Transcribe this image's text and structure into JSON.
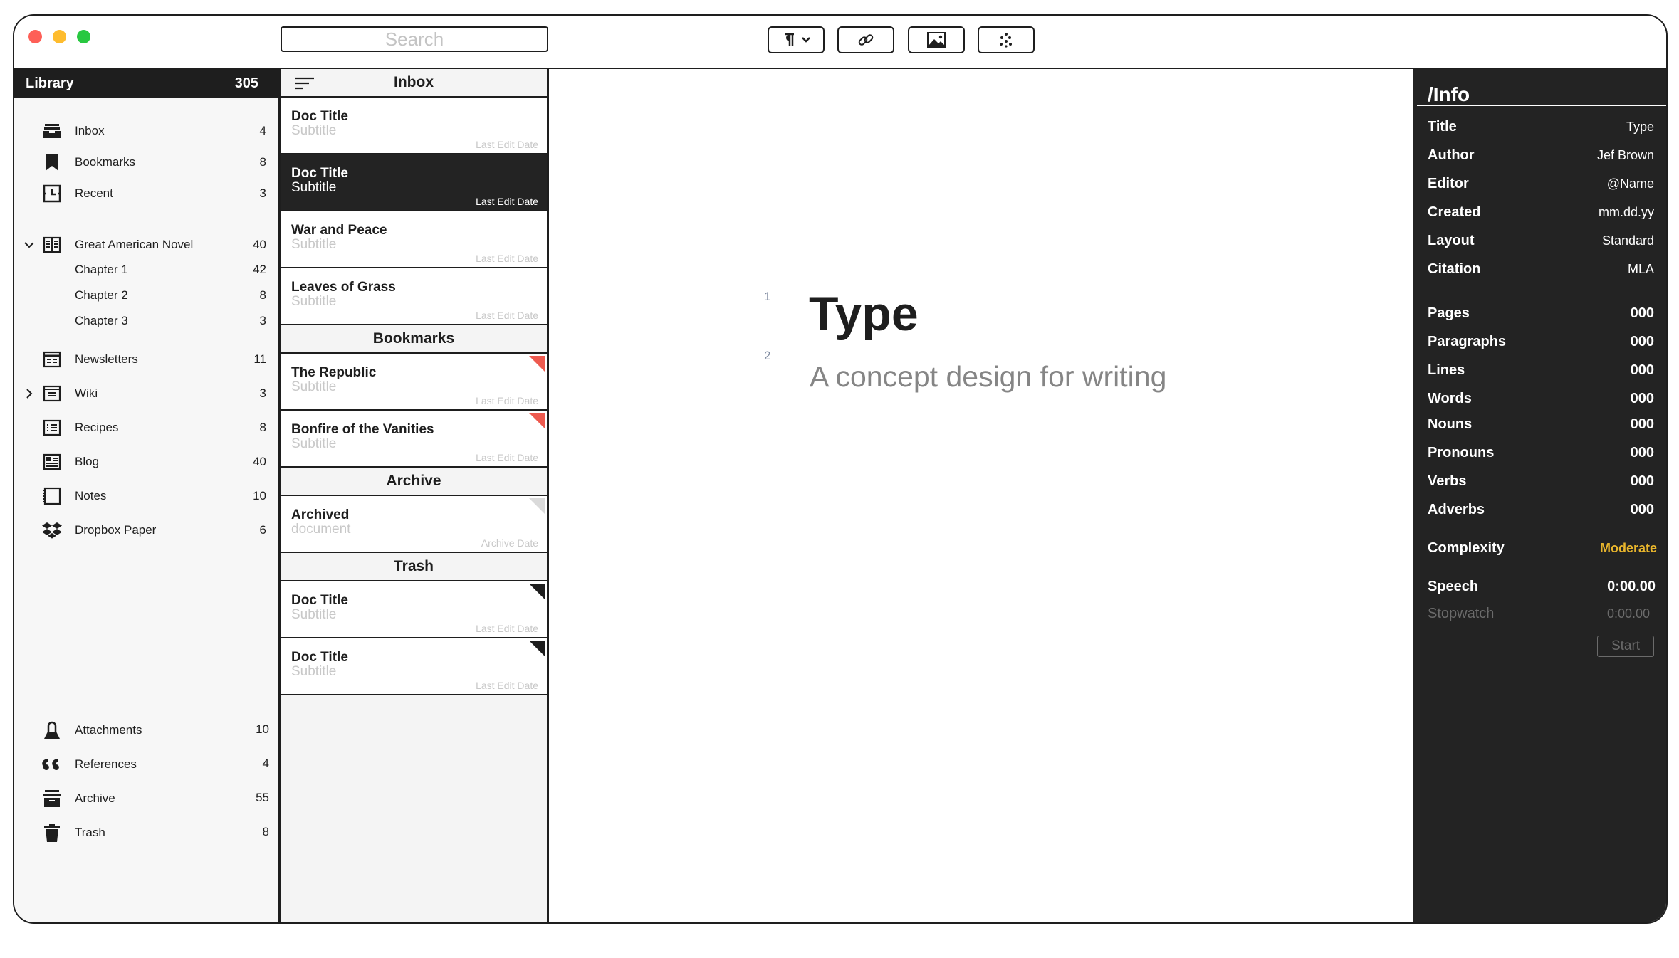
{
  "toolbar": {
    "search_placeholder": "Search",
    "buttons": [
      "paragraph-style",
      "link",
      "image",
      "ai-dots"
    ]
  },
  "library": {
    "title": "Library",
    "count": "305",
    "items": [
      {
        "label": "Inbox",
        "count": "4",
        "icon": "inbox-icon"
      },
      {
        "label": "Bookmarks",
        "count": "8",
        "icon": "bookmark-icon"
      },
      {
        "label": "Recent",
        "count": "3",
        "icon": "recent-icon"
      },
      {
        "label": "Great American Novel",
        "count": "40",
        "icon": "book-icon",
        "expanded": true
      },
      {
        "label": "Chapter 1",
        "count": "42"
      },
      {
        "label": "Chapter 2",
        "count": "8"
      },
      {
        "label": "Chapter 3",
        "count": "3"
      },
      {
        "label": "Newsletters",
        "count": "11",
        "icon": "newsletter-icon"
      },
      {
        "label": "Wiki",
        "count": "3",
        "icon": "wiki-icon",
        "expanded": false
      },
      {
        "label": "Recipes",
        "count": "8",
        "icon": "recipes-icon"
      },
      {
        "label": "Blog",
        "count": "40",
        "icon": "blog-icon"
      },
      {
        "label": "Notes",
        "count": "10",
        "icon": "notes-icon"
      },
      {
        "label": "Dropbox Paper",
        "count": "6",
        "icon": "dropbox-icon"
      }
    ],
    "bottom_items": [
      {
        "label": "Attachments",
        "count": "10",
        "icon": "attachment-icon"
      },
      {
        "label": "References",
        "count": "4",
        "icon": "quote-icon"
      },
      {
        "label": "Archive",
        "count": "55",
        "icon": "archive-icon"
      },
      {
        "label": "Trash",
        "count": "8",
        "icon": "trash-icon"
      }
    ]
  },
  "doclist": {
    "inbox_header": "Inbox",
    "bookmarks_header": "Bookmarks",
    "archive_header": "Archive",
    "trash_header": "Trash",
    "docs": [
      {
        "title": "Doc Title",
        "subtitle": "Subtitle",
        "date": "Last Edit Date"
      },
      {
        "title": "Doc Title",
        "subtitle": "Subtitle",
        "date": "Last Edit Date",
        "selected": true
      },
      {
        "title": "War and Peace",
        "subtitle": "Subtitle",
        "date": "Last Edit Date"
      },
      {
        "title": "Leaves of Grass",
        "subtitle": "Subtitle",
        "date": "Last Edit Date"
      },
      {
        "title": "The Republic",
        "subtitle": "Subtitle",
        "date": "Last Edit Date",
        "flag": "#ee5a4f"
      },
      {
        "title": "Bonfire of the Vanities",
        "subtitle": "Subtitle",
        "date": "Last Edit Date",
        "flag": "#ee5a4f"
      },
      {
        "title": "Archived",
        "subtitle": "document",
        "date": "Archive Date",
        "flag": "#dadada"
      },
      {
        "title": "Doc Title",
        "subtitle": "Subtitle",
        "date": "Last Edit Date",
        "flag": "#1e1e1e"
      },
      {
        "title": "Doc Title",
        "subtitle": "Subtitle",
        "date": "Last Edit Date",
        "flag": "#1e1e1e"
      }
    ]
  },
  "editor": {
    "line1": "1",
    "line2": "2",
    "title": "Type",
    "subtitle": "A concept design for writing"
  },
  "info": {
    "header": "/Info",
    "meta": [
      {
        "k": "Title",
        "v": "Type"
      },
      {
        "k": "Author",
        "v": "Jef Brown"
      },
      {
        "k": "Editor",
        "v": "@Name"
      },
      {
        "k": "Created",
        "v": "mm.dd.yy"
      },
      {
        "k": "Layout",
        "v": "Standard"
      },
      {
        "k": "Citation",
        "v": "MLA"
      }
    ],
    "stats": [
      {
        "k": "Pages",
        "v": "000"
      },
      {
        "k": "Paragraphs",
        "v": "000"
      },
      {
        "k": "Lines",
        "v": "000"
      },
      {
        "k": "Words",
        "v": "000"
      },
      {
        "k": "Nouns",
        "v": "000"
      },
      {
        "k": "Pronouns",
        "v": "000"
      },
      {
        "k": "Verbs",
        "v": "000"
      },
      {
        "k": "Adverbs",
        "v": "000"
      }
    ],
    "complexity_label": "Complexity",
    "complexity_value": "Moderate",
    "speech_label": "Speech",
    "speech_value": "0:00.00",
    "stopwatch_label": "Stopwatch",
    "stopwatch_value": "0:00.00",
    "start_label": "Start"
  },
  "colors": {
    "dark": "#232323",
    "accent_yellow": "#e8b52c",
    "flag_red": "#ee5a4f"
  }
}
